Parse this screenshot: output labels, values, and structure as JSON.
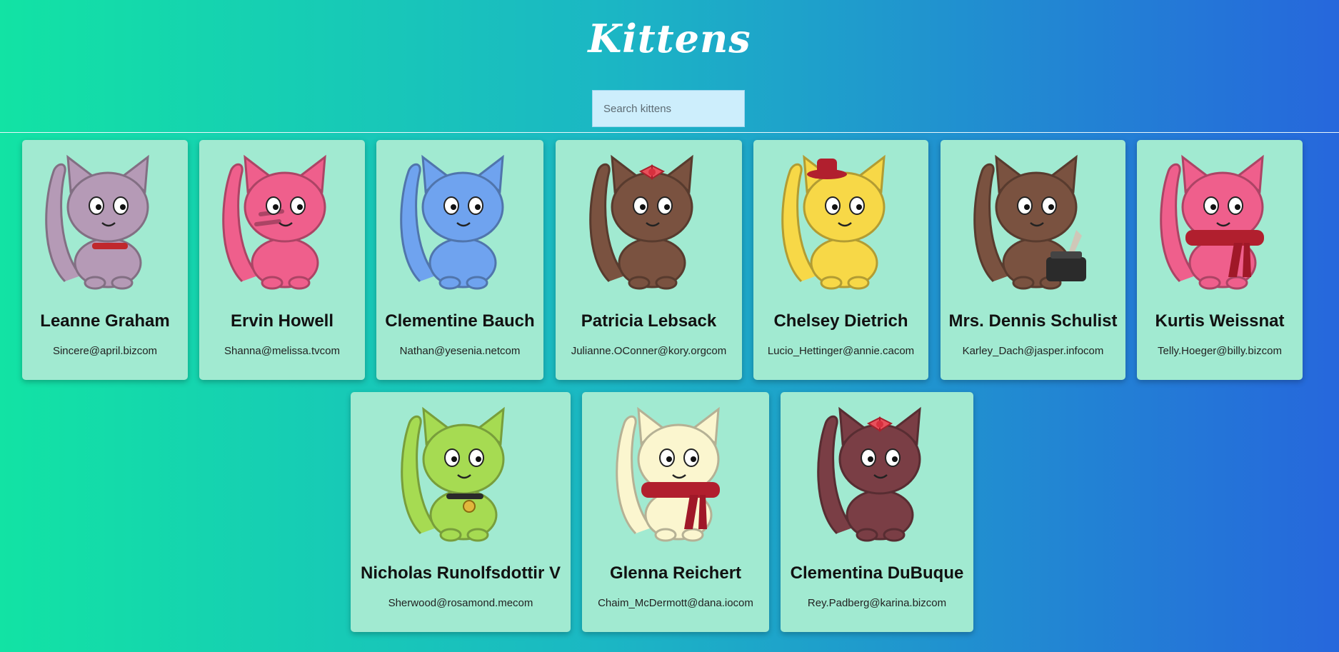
{
  "header": {
    "title": "Kittens"
  },
  "search": {
    "placeholder": "Search kittens",
    "value": ""
  },
  "cards": [
    {
      "name": "Leanne Graham",
      "email": "Sincere@april.bizcom",
      "color": "#b59ab6",
      "accessory": "collar"
    },
    {
      "name": "Ervin Howell",
      "email": "Shanna@melissa.tvcom",
      "color": "#ef5f8c",
      "accessory": "stripes"
    },
    {
      "name": "Clementine Bauch",
      "email": "Nathan@yesenia.netcom",
      "color": "#6fa3ef",
      "accessory": "none"
    },
    {
      "name": "Patricia Lebsack",
      "email": "Julianne.OConner@kory.orgcom",
      "color": "#7a5240",
      "accessory": "bow"
    },
    {
      "name": "Chelsey Dietrich",
      "email": "Lucio_Hettinger@annie.cacom",
      "color": "#f7d847",
      "accessory": "hat"
    },
    {
      "name": "Mrs. Dennis Schulist",
      "email": "Karley_Dach@jasper.infocom",
      "color": "#7a5240",
      "accessory": "typewriter"
    },
    {
      "name": "Kurtis Weissnat",
      "email": "Telly.Hoeger@billy.bizcom",
      "color": "#ef5f8c",
      "accessory": "scarf"
    },
    {
      "name": "Nicholas Runolfsdottir V",
      "email": "Sherwood@rosamond.mecom",
      "color": "#a6db52",
      "accessory": "bell"
    },
    {
      "name": "Glenna Reichert",
      "email": "Chaim_McDermott@dana.iocom",
      "color": "#fbf6cf",
      "accessory": "scarf"
    },
    {
      "name": "Clementina DuBuque",
      "email": "Rey.Padberg@karina.bizcom",
      "color": "#7a3e45",
      "accessory": "bow"
    }
  ],
  "colors": {
    "card": "#a1ead1",
    "gradient_start": "#12e3a4",
    "gradient_end": "#2667dc",
    "accent_red": "#b11f2e"
  }
}
